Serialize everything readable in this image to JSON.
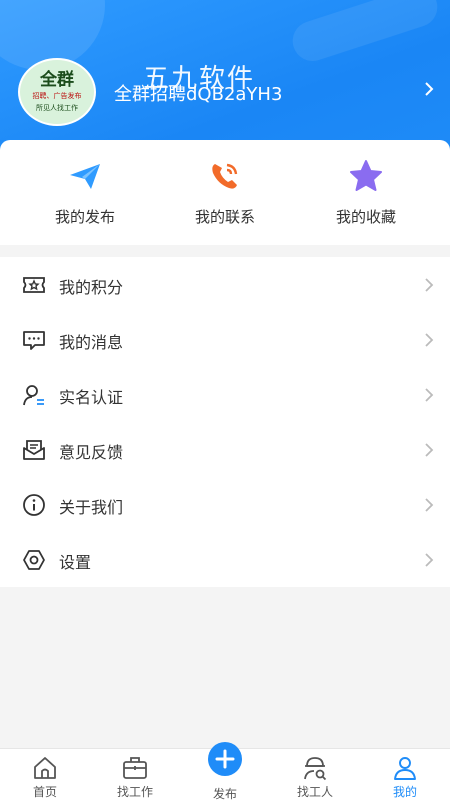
{
  "header": {
    "avatar_text_main": "全群",
    "avatar_text_sub": "招聘、广告发布",
    "avatar_text_bottom": "所见人找工作",
    "watermark": "五九软件",
    "username": "全群招聘dQB2aYH3"
  },
  "quick_actions": [
    {
      "label": "我的发布",
      "icon": "paper-plane-icon",
      "color": "#2f9bff"
    },
    {
      "label": "我的联系",
      "icon": "phone-icon",
      "color": "#f26b2a"
    },
    {
      "label": "我的收藏",
      "icon": "star-icon",
      "color": "#8a6cf0"
    }
  ],
  "menu": [
    {
      "label": "我的积分",
      "icon": "points-ticket-icon"
    },
    {
      "label": "我的消息",
      "icon": "message-icon"
    },
    {
      "label": "实名认证",
      "icon": "user-verify-icon"
    },
    {
      "label": "意见反馈",
      "icon": "feedback-mail-icon"
    },
    {
      "label": "关于我们",
      "icon": "info-icon"
    },
    {
      "label": "设置",
      "icon": "settings-hexagon-icon"
    }
  ],
  "tabbar": [
    {
      "label": "首页",
      "icon": "home-icon"
    },
    {
      "label": "找工作",
      "icon": "briefcase-icon"
    },
    {
      "label": "发布",
      "icon": "plus-icon"
    },
    {
      "label": "找工人",
      "icon": "worker-search-icon"
    },
    {
      "label": "我的",
      "icon": "person-icon",
      "active": true
    }
  ],
  "colors": {
    "primary": "#1f8cf8",
    "text": "#333333",
    "chevron": "#bbbbbb"
  }
}
